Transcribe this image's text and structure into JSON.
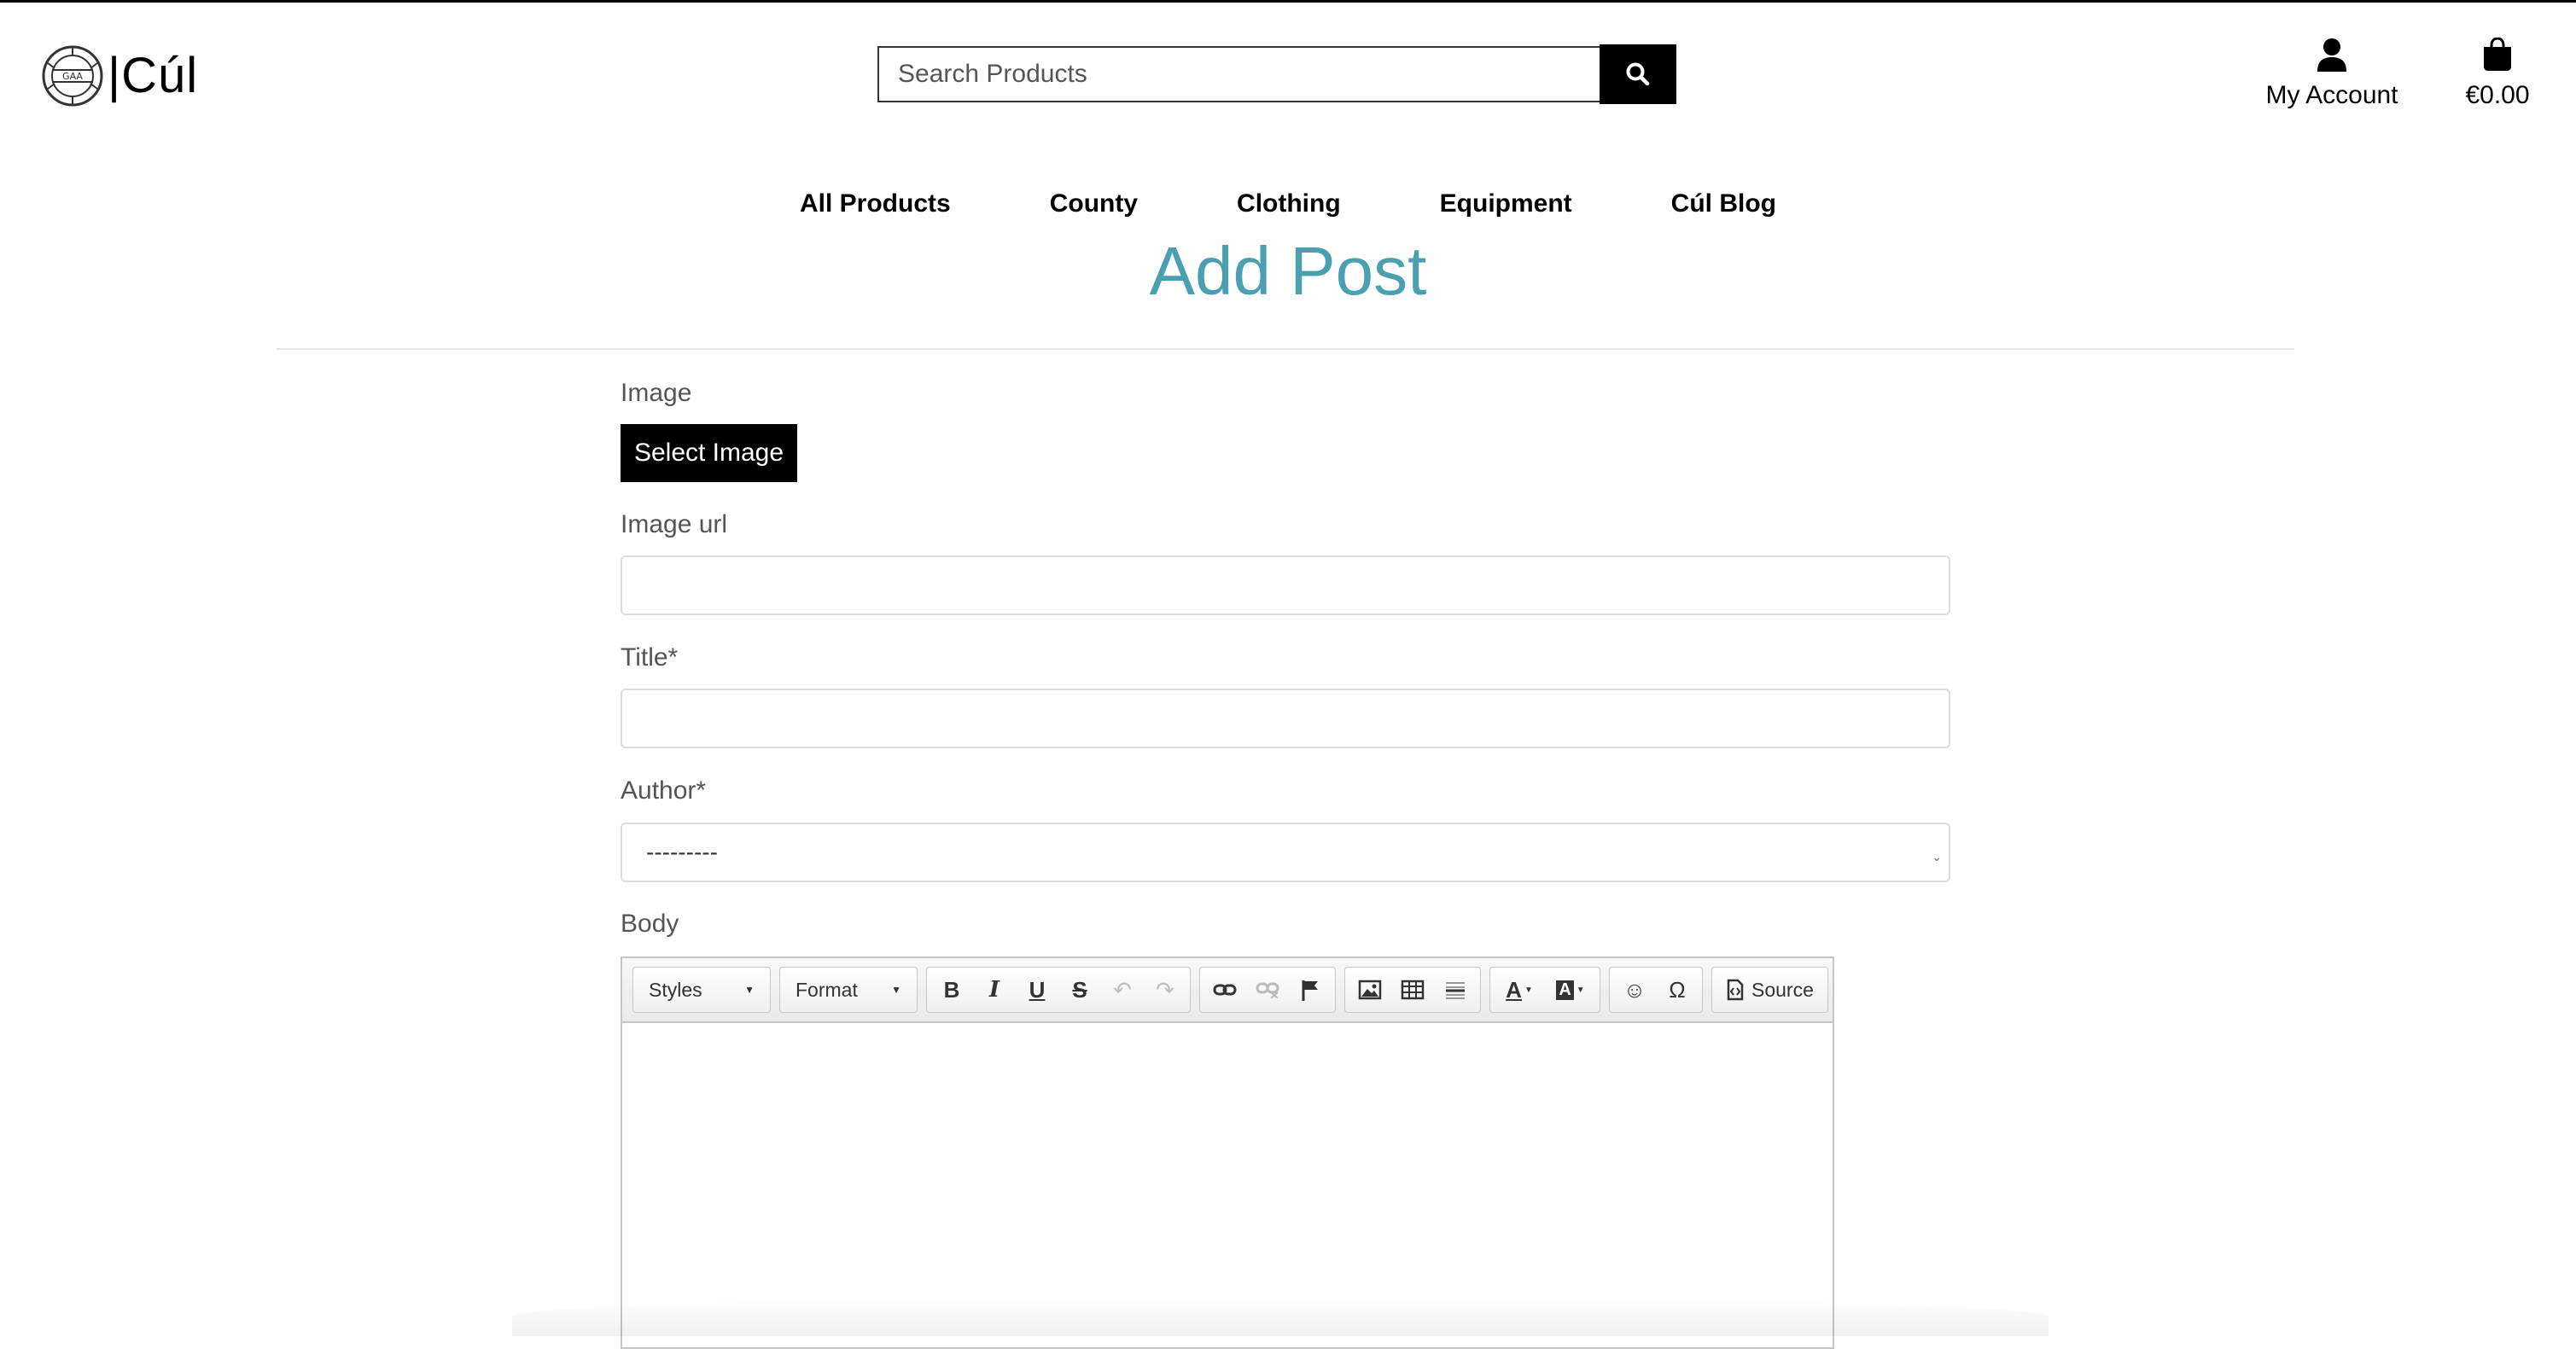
{
  "header": {
    "logo_text": "|Cúl",
    "search_placeholder": "Search Products",
    "account_label": "My Account",
    "bag_total": "€0.00"
  },
  "nav": {
    "items": [
      "All Products",
      "County",
      "Clothing",
      "Equipment",
      "Cúl Blog"
    ]
  },
  "page": {
    "title": "Add Post"
  },
  "form": {
    "image_label": "Image",
    "select_image_button": "Select Image",
    "image_url_label": "Image url",
    "image_url_value": "",
    "title_label": "Title*",
    "title_value": "",
    "author_label": "Author*",
    "author_selected": "---------",
    "body_label": "Body"
  },
  "editor": {
    "styles_combo": "Styles",
    "format_combo": "Format",
    "source_label": "Source",
    "buttons": [
      "bold-icon",
      "italic-icon",
      "underline-icon",
      "strike-icon",
      "undo-icon",
      "redo-icon",
      "link-icon",
      "unlink-icon",
      "anchor-flag-icon",
      "image-icon",
      "table-icon",
      "horizontal-rule-icon",
      "text-color-icon",
      "background-color-icon",
      "smiley-icon",
      "special-char-icon"
    ]
  },
  "colors": {
    "title_accent": "#4a9fb1",
    "primary_button": "#000000"
  }
}
